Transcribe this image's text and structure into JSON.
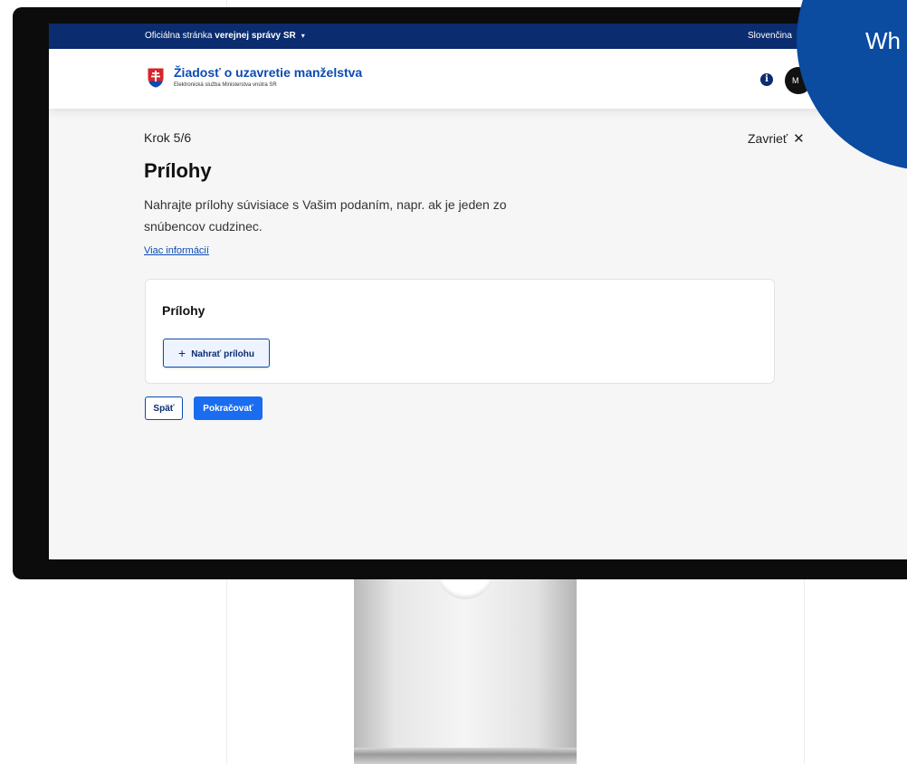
{
  "topbar": {
    "official_prefix": "Oficiálna stránka ",
    "official_bold": "verejnej správy SR",
    "caret": "▾",
    "language": "Slovenčina"
  },
  "header": {
    "title": "Žiadosť o uzavretie manželstva",
    "subtitle": "Elektronická služba Ministerstva vnútra SR",
    "info": "i",
    "avatar_initial": "M"
  },
  "page": {
    "step": "Krok 5/6",
    "close_label": "Zavrieť",
    "close_icon": "✕",
    "title": "Prílohy",
    "lead": "Nahrajte prílohy súvisiace s Vašim podaním, napr. ak je jeden zo snúbencov cudzinec.",
    "more_info": "Viac informácií"
  },
  "card": {
    "title": "Prílohy",
    "upload_plus": "+",
    "upload_label": "Nahrať prílohu"
  },
  "actions": {
    "back_label": "Späť",
    "next_label": "Pokračovať"
  },
  "overlay": {
    "text": "Wh"
  },
  "colors": {
    "topbar": "#0b2c6e",
    "brand": "#0b4bb3",
    "primary_button": "#1a6cf0",
    "overlay_blob": "#0b4ba0"
  }
}
